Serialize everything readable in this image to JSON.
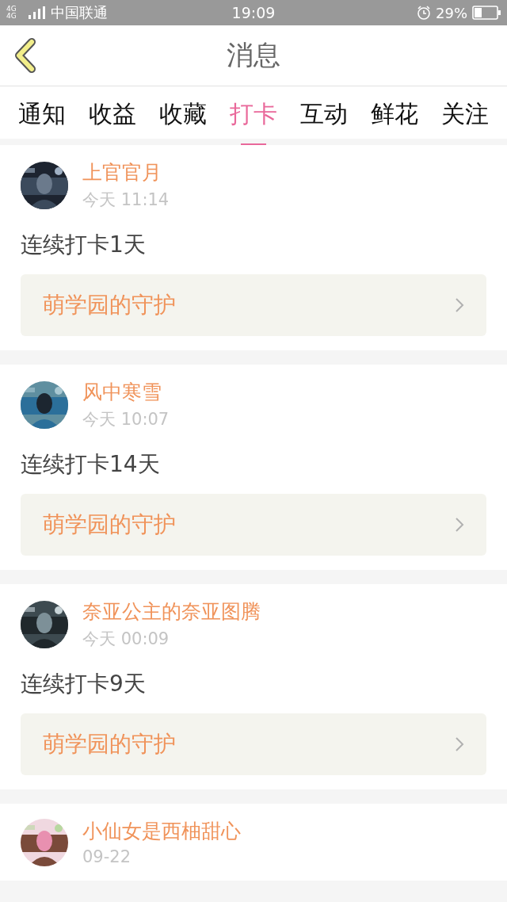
{
  "status_bar": {
    "carrier": "中国联通",
    "network": "4G 4G",
    "time": "19:09",
    "battery": "29%"
  },
  "header": {
    "title": "消息"
  },
  "tabs": [
    {
      "label": "通知",
      "selected": false
    },
    {
      "label": "收益",
      "selected": false
    },
    {
      "label": "收藏",
      "selected": false
    },
    {
      "label": "打卡",
      "selected": true
    },
    {
      "label": "互动",
      "selected": false
    },
    {
      "label": "鲜花",
      "selected": false
    },
    {
      "label": "关注",
      "selected": false
    }
  ],
  "checkins": [
    {
      "name": "上官官月",
      "time": "今天 11:14",
      "streak": "连续打卡1天",
      "badge": "萌学园的守护"
    },
    {
      "name": "风中寒雪",
      "time": "今天 10:07",
      "streak": "连续打卡14天",
      "badge": "萌学园的守护"
    },
    {
      "name": "奈亚公主的奈亚图腾",
      "time": "今天 00:09",
      "streak": "连续打卡9天",
      "badge": "萌学园的守护"
    },
    {
      "name": "小仙女是西柚甜心",
      "time": "09-22"
    }
  ]
}
